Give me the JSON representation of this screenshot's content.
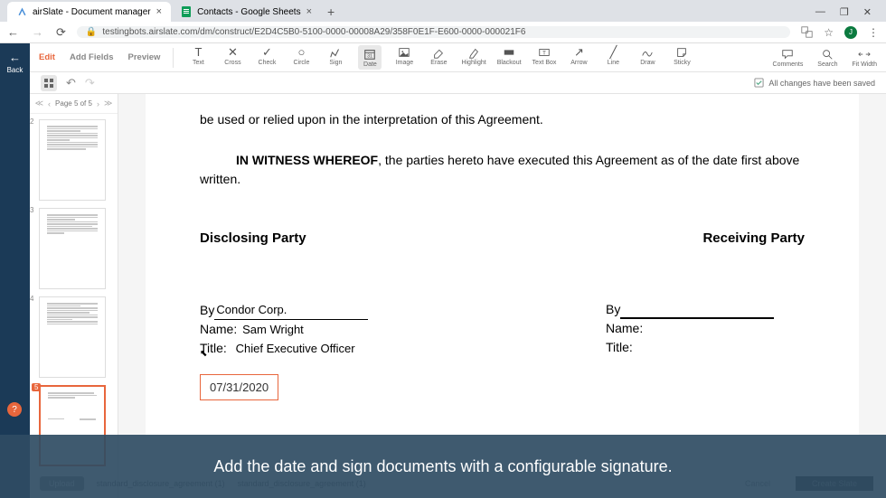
{
  "browser": {
    "tabs": [
      {
        "title": "airSlate - Document manager",
        "icon_color": "#4a90d9"
      },
      {
        "title": "Contacts - Google Sheets",
        "icon_color": "#0f9d58"
      }
    ],
    "url": "testingbots.airslate.com/dm/construct/E2D4C5B0-5100-0000-00008A29/358F0E1F-E600-0000-000021F6",
    "window_controls": {
      "min": "—",
      "max": "❐",
      "close": "✕"
    }
  },
  "back_btn": {
    "label": "Back"
  },
  "mode_tabs": {
    "edit": "Edit",
    "add_fields": "Add Fields",
    "preview": "Preview"
  },
  "tools": {
    "text": "Text",
    "cross": "Cross",
    "check": "Check",
    "circle": "Circle",
    "sign": "Sign",
    "date": "Date",
    "image": "Image",
    "erase": "Erase",
    "highlight": "Highlight",
    "blackout": "Blackout",
    "textbox": "Text Box",
    "arrow": "Arrow",
    "line": "Line",
    "draw": "Draw",
    "sticky": "Sticky",
    "comments": "Comments",
    "search": "Search",
    "fitwidth": "Fit Width"
  },
  "status": {
    "page_label": "Page 5 of 5",
    "saved": "All changes have been saved"
  },
  "thumbnails": {
    "pages": [
      2,
      3,
      4,
      5
    ],
    "active": 5
  },
  "document": {
    "truncated_line": "be used or relied upon in the interpretation of this Agreement.",
    "witness_bold": "IN WITNESS WHEREOF",
    "witness_rest": ", the parties hereto have executed this Agreement as of the date first above written.",
    "disclosing_label": "Disclosing Party",
    "receiving_label": "Receiving Party",
    "by_label": "By",
    "name_label": "Name:",
    "title_label": "Title:",
    "disclosing": {
      "by": "Condor Corp.",
      "name": "Sam Wright",
      "title": "Chief Executive Officer"
    },
    "receiving": {
      "by": "",
      "name": "",
      "title": ""
    },
    "date_value": "07/31/2020"
  },
  "caption": "Add the date and sign documents with a configurable signature.",
  "hidden_footer": {
    "upload": "Upload",
    "doc1": "standard_disclosure_agreement (1)",
    "doc2": "standard_disclosure_agreement (1)",
    "cancel": "Cancel",
    "create": "Create Slate"
  },
  "colors": {
    "accent": "#e8663c",
    "header": "#1b3a57"
  }
}
